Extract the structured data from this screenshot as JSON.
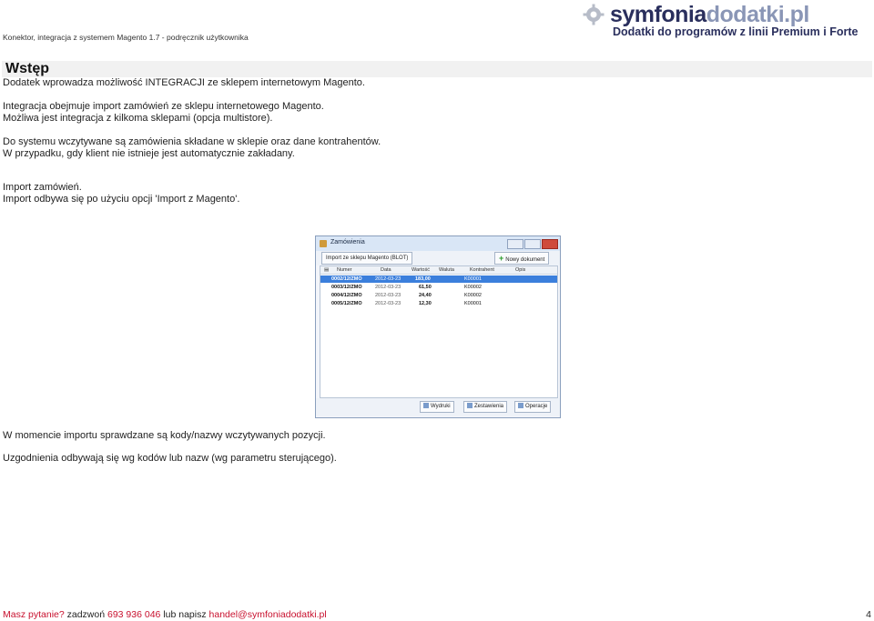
{
  "header": {
    "doc_title": "Konektor, integracja z systemem Magento 1.7  - podręcznik użytkownika",
    "logo": {
      "brand_dark": "symfonia",
      "brand_light": "dodatki.pl",
      "tagline": "Dodatki do programów z linii Premium i Forte"
    }
  },
  "section": {
    "title": "Wstęp"
  },
  "paragraphs": [
    "Dodatek wprowadza możliwość INTEGRACJI ze sklepem internetowym Magento.",
    "Integracja obejmuje import zamówień ze sklepu internetowego Magento.",
    "Możliwa jest integracja z kilkoma sklepami (opcja multistore).",
    "Do systemu wczytywane są zamówienia składane w sklepie oraz dane kontrahentów.",
    "W przypadku, gdy klient nie istnieje jest automatycznie zakładany.",
    "Import zamówień.",
    "Import odbywa się po użyciu opcji 'Import z Magento'.",
    "W momencie importu sprawdzane są kody/nazwy wczytywanych pozycji.",
    "Uzgodnienia odbywają się wg kodów lub nazw (wg parametru sterującego)."
  ],
  "screenshot": {
    "window_title": "Zamówienia",
    "import_button": "Import ze sklepu Magento (BLOT)",
    "new_doc_button": "Nowy dokument",
    "columns": [
      "Numer",
      "Data",
      "Wartość",
      "Waluta",
      "Kontrahent",
      "Opis"
    ],
    "rows": [
      {
        "numer": "0002/12/ZMO",
        "data": "2012-03-23",
        "wartosc": "183,00",
        "waluta": "",
        "kontrahent": "K00001",
        "opis": "",
        "selected": true
      },
      {
        "numer": "0003/12/ZMO",
        "data": "2012-03-23",
        "wartosc": "61,50",
        "waluta": "",
        "kontrahent": "K00002",
        "opis": "",
        "selected": false
      },
      {
        "numer": "0004/12/ZMO",
        "data": "2012-03-23",
        "wartosc": "24,40",
        "waluta": "",
        "kontrahent": "K00002",
        "opis": "",
        "selected": false
      },
      {
        "numer": "0005/12/ZMO",
        "data": "2012-03-23",
        "wartosc": "12,30",
        "waluta": "",
        "kontrahent": "K00001",
        "opis": "",
        "selected": false
      }
    ],
    "bottom_buttons": [
      "Wydruki",
      "Zestawienia",
      "Operacje"
    ]
  },
  "footer": {
    "question": "Masz pytanie?",
    "call": "zadzwoń",
    "phone": "693 936 046",
    "or_write": "lub napisz",
    "email": "handel@symfoniadodatki.pl",
    "page_number": "4"
  },
  "colors": {
    "accent_red": "#c8102e",
    "brand_navy": "#2a2f5d",
    "selection_blue": "#3b7fdc"
  }
}
